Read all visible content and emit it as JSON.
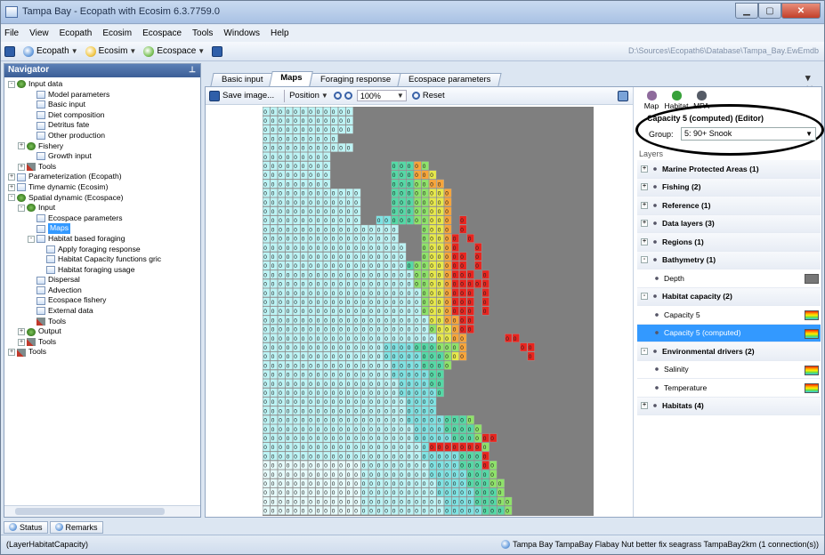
{
  "window": {
    "title": "Tampa Bay - Ecopath with Ecosim 6.3.7759.0"
  },
  "menubar": [
    "File",
    "View",
    "Ecopath",
    "Ecosim",
    "Ecospace",
    "Tools",
    "Windows",
    "Help"
  ],
  "toolbar": {
    "ecopath": "Ecopath",
    "ecosim": "Ecosim",
    "ecospace": "Ecospace",
    "path": "D:\\Sources\\Ecopath6\\Database\\Tampa_Bay.EwEmdb"
  },
  "navigator": {
    "title": "Navigator",
    "nodes": [
      {
        "label": "Input data",
        "lvl": 0,
        "exp": "-",
        "icon": "g"
      },
      {
        "label": "Model parameters",
        "lvl": 2,
        "exp": "",
        "icon": "f"
      },
      {
        "label": "Basic input",
        "lvl": 2,
        "exp": "",
        "icon": "f"
      },
      {
        "label": "Diet composition",
        "lvl": 2,
        "exp": "",
        "icon": "f"
      },
      {
        "label": "Detritus fate",
        "lvl": 2,
        "exp": "",
        "icon": "f"
      },
      {
        "label": "Other production",
        "lvl": 2,
        "exp": "",
        "icon": "f"
      },
      {
        "label": "Fishery",
        "lvl": 1,
        "exp": "+",
        "icon": "g"
      },
      {
        "label": "Growth input",
        "lvl": 2,
        "exp": "",
        "icon": "f"
      },
      {
        "label": "Tools",
        "lvl": 1,
        "exp": "+",
        "icon": "t"
      },
      {
        "label": "Parameterization (Ecopath)",
        "lvl": 0,
        "exp": "+",
        "icon": "f"
      },
      {
        "label": "Time dynamic (Ecosim)",
        "lvl": 0,
        "exp": "+",
        "icon": "f"
      },
      {
        "label": "Spatial dynamic (Ecospace)",
        "lvl": 0,
        "exp": "-",
        "icon": "g"
      },
      {
        "label": "Input",
        "lvl": 1,
        "exp": "-",
        "icon": "g"
      },
      {
        "label": "Ecospace parameters",
        "lvl": 2,
        "exp": "",
        "icon": "f"
      },
      {
        "label": "Maps",
        "lvl": 2,
        "exp": "",
        "icon": "f",
        "sel": true
      },
      {
        "label": "Habitat based foraging",
        "lvl": 2,
        "exp": "-",
        "icon": "f"
      },
      {
        "label": "Apply foraging response",
        "lvl": 3,
        "exp": "",
        "icon": "f"
      },
      {
        "label": "Habitat Capacity functions gric",
        "lvl": 3,
        "exp": "",
        "icon": "f"
      },
      {
        "label": "Habitat foraging usage",
        "lvl": 3,
        "exp": "",
        "icon": "f"
      },
      {
        "label": "Dispersal",
        "lvl": 2,
        "exp": "",
        "icon": "f"
      },
      {
        "label": "Advection",
        "lvl": 2,
        "exp": "",
        "icon": "f"
      },
      {
        "label": "Ecospace fishery",
        "lvl": 2,
        "exp": "",
        "icon": "f"
      },
      {
        "label": "External data",
        "lvl": 2,
        "exp": "",
        "icon": "f"
      },
      {
        "label": "Tools",
        "lvl": 2,
        "exp": "",
        "icon": "t"
      },
      {
        "label": "Output",
        "lvl": 1,
        "exp": "+",
        "icon": "g"
      },
      {
        "label": "Tools",
        "lvl": 1,
        "exp": "+",
        "icon": "t"
      },
      {
        "label": "Tools",
        "lvl": 0,
        "exp": "+",
        "icon": "t"
      }
    ]
  },
  "tabs": [
    {
      "label": "Basic input"
    },
    {
      "label": "Maps",
      "active": true
    },
    {
      "label": "Foraging response"
    },
    {
      "label": "Ecospace parameters"
    }
  ],
  "maptoolbar": {
    "save": "Save image...",
    "position": "Position",
    "zoom": "100%",
    "reset": "Reset"
  },
  "rightpanel": {
    "tools": [
      {
        "label": "Map",
        "color": "#8e6b9c"
      },
      {
        "label": "Habitat",
        "color": "#37a13a"
      },
      {
        "label": "MPA",
        "color": "#555b66"
      }
    ],
    "editor_title": "Capacity 5 (computed) (Editor)",
    "group_label": "Group:",
    "group_value": "5: 90+ Snook",
    "layers_label": "Layers",
    "layers": [
      {
        "label": "Marine Protected Areas (1)",
        "kind": "grp",
        "exp": "+"
      },
      {
        "label": "Fishing (2)",
        "kind": "grp",
        "exp": "+"
      },
      {
        "label": "Reference (1)",
        "kind": "grp",
        "exp": "+"
      },
      {
        "label": "Data layers (3)",
        "kind": "grp",
        "exp": "+"
      },
      {
        "label": "Regions (1)",
        "kind": "grp",
        "exp": "+"
      },
      {
        "label": "Bathymetry (1)",
        "kind": "grp",
        "exp": "-"
      },
      {
        "label": "Depth",
        "kind": "child",
        "swatch": "dark"
      },
      {
        "label": "Habitat capacity (2)",
        "kind": "grp",
        "exp": "-"
      },
      {
        "label": "Capacity 5",
        "kind": "child",
        "swatch": "rain"
      },
      {
        "label": "Capacity 5 (computed)",
        "kind": "child",
        "swatch": "rain",
        "sel": true
      },
      {
        "label": "Environmental drivers (2)",
        "kind": "grp",
        "exp": "-"
      },
      {
        "label": "Salinity",
        "kind": "child",
        "swatch": "rain"
      },
      {
        "label": "Temperature",
        "kind": "child",
        "swatch": "rain"
      },
      {
        "label": "Habitats (4)",
        "kind": "grp",
        "exp": "+"
      }
    ]
  },
  "bottom_tabs": [
    "Status",
    "Remarks"
  ],
  "status": {
    "left": "(LayerHabitatCapacity)",
    "right": "Tampa Bay   TampaBay Flabay Nut better fix seagrass   TampaBay2km (1 connection(s))"
  },
  "map": {
    "cell_label": "0.0",
    "land_color": "#7f7f7f",
    "water_color": "#bdf4f5"
  }
}
